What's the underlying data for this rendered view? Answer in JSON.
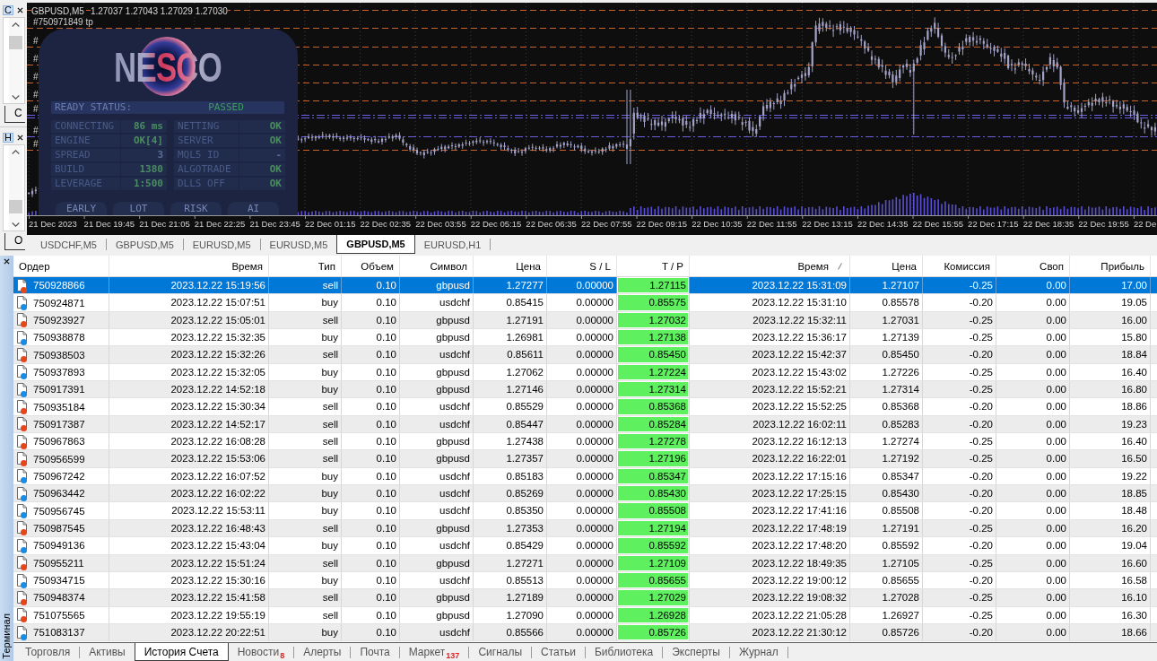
{
  "side_panels": [
    {
      "tab": "C",
      "label": "C"
    },
    {
      "tab": "H",
      "label": "O"
    }
  ],
  "chart": {
    "symbol": "GBPUSD,M5",
    "prices": "1.27037 1.27043 1.27029 1.27030",
    "line_labels": [
      "#750971849 tp",
      "#",
      "#",
      "#",
      "#",
      "#",
      "#",
      "#"
    ],
    "time_axis": [
      "21 Dec 2023",
      "21 Dec 19:45",
      "21 Dec 21:05",
      "21 Dec 22:25",
      "21 Dec 23:45",
      "22 Dec 01:15",
      "22 Dec 02:35",
      "22 Dec 03:55",
      "22 Dec 05:15",
      "22 Dec 06:35",
      "22 Dec 07:55",
      "22 Dec 09:15",
      "22 Dec 10:35",
      "22 Dec 11:55",
      "22 Dec 13:15",
      "22 Dec 14:35",
      "22 Dec 15:55",
      "22 Dec 17:15",
      "22 Dec 18:35",
      "22 Dec 19:55",
      "22 De"
    ],
    "status_panel": {
      "logo": "NESCO",
      "status": {
        "label": "READY STATUS:",
        "value": "PASSED"
      },
      "stats": [
        {
          "label": "CONNECTING",
          "value": "86 ms",
          "color": "#4b8c63"
        },
        {
          "label": "NETTING",
          "value": "OK",
          "color": "#4b8c63"
        },
        {
          "label": "ENGINE",
          "value": "OK[4]",
          "color": "#4b8c63"
        },
        {
          "label": "SERVER",
          "value": "OK",
          "color": "#4b8c63"
        },
        {
          "label": "SPREAD",
          "value": "3",
          "color": "#5d6d99"
        },
        {
          "label": "MQL5 ID",
          "value": "-",
          "color": "#5d6d99"
        },
        {
          "label": "BUILD",
          "value": "1380",
          "color": "#4b8c63"
        },
        {
          "label": "ALGOTRADE",
          "value": "OK",
          "color": "#4b8c63"
        },
        {
          "label": "LEVERAGE",
          "value": "1:500",
          "color": "#4b8c63"
        },
        {
          "label": "DLLS OFF",
          "value": "OK",
          "color": "#4b8c63"
        }
      ],
      "buttons": [
        "EARLY",
        "LOT",
        "RISK",
        "AI"
      ]
    }
  },
  "chart_tabs": [
    {
      "label": "USDCHF,M5",
      "selected": false
    },
    {
      "label": "GBPUSD,M5",
      "selected": false
    },
    {
      "label": "EURUSD,M5",
      "selected": false
    },
    {
      "label": "EURUSD,M5",
      "selected": false
    },
    {
      "label": "GBPUSD,M5",
      "selected": true
    },
    {
      "label": "EURUSD,H1",
      "selected": false
    }
  ],
  "terminal": {
    "title": "Терминал",
    "columns": [
      {
        "label": "Ордер",
        "sorted": false,
        "highlighted": false
      },
      {
        "label": "Время",
        "sorted": false,
        "highlighted": false
      },
      {
        "label": "Тип",
        "sorted": false,
        "highlighted": false
      },
      {
        "label": "Объем",
        "sorted": false,
        "highlighted": false
      },
      {
        "label": "Символ",
        "sorted": false,
        "highlighted": false
      },
      {
        "label": "Цена",
        "sorted": false,
        "highlighted": false
      },
      {
        "label": "S / L",
        "sorted": false,
        "highlighted": false
      },
      {
        "label": "T / P",
        "sorted": false,
        "highlighted": true
      },
      {
        "label": "Время",
        "sorted": true,
        "highlighted": false
      },
      {
        "label": "Цена",
        "sorted": false,
        "highlighted": false
      },
      {
        "label": "Комиссия",
        "sorted": false,
        "highlighted": false
      },
      {
        "label": "Своп",
        "sorted": false,
        "highlighted": false
      },
      {
        "label": "Прибыль",
        "sorted": false,
        "highlighted": false
      }
    ],
    "rows": [
      {
        "selected": true,
        "color": "#e4471c",
        "cells": [
          "750928866",
          "2023.12.22 15:19:56",
          "sell",
          "0.10",
          "gbpusd",
          "1.27277",
          "0.00000",
          "1.27115",
          "2023.12.22 15:31:09",
          "1.27107",
          "-0.25",
          "0.00",
          "17.00"
        ]
      },
      {
        "selected": false,
        "color": "#1c8ce3",
        "cells": [
          "750924871",
          "2023.12.22 15:07:51",
          "buy",
          "0.10",
          "usdchf",
          "0.85415",
          "0.00000",
          "0.85575",
          "2023.12.22 15:31:10",
          "0.85578",
          "-0.20",
          "0.00",
          "19.05"
        ]
      },
      {
        "selected": false,
        "color": "#e4471c",
        "cells": [
          "750923927",
          "2023.12.22 15:05:01",
          "sell",
          "0.10",
          "gbpusd",
          "1.27191",
          "0.00000",
          "1.27032",
          "2023.12.22 15:32:11",
          "1.27031",
          "-0.25",
          "0.00",
          "16.00"
        ]
      },
      {
        "selected": false,
        "color": "#1c8ce3",
        "cells": [
          "750938878",
          "2023.12.22 15:32:35",
          "buy",
          "0.10",
          "gbpusd",
          "1.26981",
          "0.00000",
          "1.27138",
          "2023.12.22 15:36:17",
          "1.27139",
          "-0.25",
          "0.00",
          "15.80"
        ]
      },
      {
        "selected": false,
        "color": "#e4471c",
        "cells": [
          "750938503",
          "2023.12.22 15:32:26",
          "sell",
          "0.10",
          "usdchf",
          "0.85611",
          "0.00000",
          "0.85450",
          "2023.12.22 15:42:37",
          "0.85450",
          "-0.20",
          "0.00",
          "18.84"
        ]
      },
      {
        "selected": false,
        "color": "#1c8ce3",
        "cells": [
          "750937893",
          "2023.12.22 15:32:05",
          "buy",
          "0.10",
          "gbpusd",
          "1.27062",
          "0.00000",
          "1.27224",
          "2023.12.22 15:43:02",
          "1.27226",
          "-0.25",
          "0.00",
          "16.40"
        ]
      },
      {
        "selected": false,
        "color": "#1c8ce3",
        "cells": [
          "750917391",
          "2023.12.22 14:52:18",
          "buy",
          "0.10",
          "gbpusd",
          "1.27146",
          "0.00000",
          "1.27314",
          "2023.12.22 15:52:21",
          "1.27314",
          "-0.25",
          "0.00",
          "16.80"
        ]
      },
      {
        "selected": false,
        "color": "#e4471c",
        "cells": [
          "750935184",
          "2023.12.22 15:30:34",
          "sell",
          "0.10",
          "usdchf",
          "0.85529",
          "0.00000",
          "0.85368",
          "2023.12.22 15:52:25",
          "0.85368",
          "-0.20",
          "0.00",
          "18.86"
        ]
      },
      {
        "selected": false,
        "color": "#e4471c",
        "cells": [
          "750917387",
          "2023.12.22 14:52:17",
          "sell",
          "0.10",
          "usdchf",
          "0.85447",
          "0.00000",
          "0.85284",
          "2023.12.22 16:02:11",
          "0.85283",
          "-0.20",
          "0.00",
          "19.23"
        ]
      },
      {
        "selected": false,
        "color": "#e4471c",
        "cells": [
          "750967863",
          "2023.12.22 16:08:28",
          "sell",
          "0.10",
          "gbpusd",
          "1.27438",
          "0.00000",
          "1.27278",
          "2023.12.22 16:12:13",
          "1.27274",
          "-0.25",
          "0.00",
          "16.40"
        ]
      },
      {
        "selected": false,
        "color": "#e4471c",
        "cells": [
          "750956599",
          "2023.12.22 15:53:06",
          "sell",
          "0.10",
          "gbpusd",
          "1.27357",
          "0.00000",
          "1.27196",
          "2023.12.22 16:22:01",
          "1.27192",
          "-0.25",
          "0.00",
          "16.50"
        ]
      },
      {
        "selected": false,
        "color": "#1c8ce3",
        "cells": [
          "750967242",
          "2023.12.22 16:07:52",
          "buy",
          "0.10",
          "usdchf",
          "0.85183",
          "0.00000",
          "0.85347",
          "2023.12.22 17:15:16",
          "0.85347",
          "-0.20",
          "0.00",
          "19.22"
        ]
      },
      {
        "selected": false,
        "color": "#1c8ce3",
        "cells": [
          "750963442",
          "2023.12.22 16:02:22",
          "buy",
          "0.10",
          "usdchf",
          "0.85269",
          "0.00000",
          "0.85430",
          "2023.12.22 17:25:15",
          "0.85430",
          "-0.20",
          "0.00",
          "18.85"
        ]
      },
      {
        "selected": false,
        "color": "#1c8ce3",
        "cells": [
          "750956745",
          "2023.12.22 15:53:11",
          "buy",
          "0.10",
          "usdchf",
          "0.85350",
          "0.00000",
          "0.85508",
          "2023.12.22 17:41:16",
          "0.85508",
          "-0.20",
          "0.00",
          "18.48"
        ]
      },
      {
        "selected": false,
        "color": "#e4471c",
        "cells": [
          "750987545",
          "2023.12.22 16:48:43",
          "sell",
          "0.10",
          "gbpusd",
          "1.27353",
          "0.00000",
          "1.27194",
          "2023.12.22 17:48:19",
          "1.27191",
          "-0.25",
          "0.00",
          "16.20"
        ]
      },
      {
        "selected": false,
        "color": "#1c8ce3",
        "cells": [
          "750949136",
          "2023.12.22 15:43:04",
          "buy",
          "0.10",
          "usdchf",
          "0.85429",
          "0.00000",
          "0.85592",
          "2023.12.22 17:48:20",
          "0.85592",
          "-0.20",
          "0.00",
          "19.04"
        ]
      },
      {
        "selected": false,
        "color": "#e4471c",
        "cells": [
          "750955211",
          "2023.12.22 15:51:24",
          "sell",
          "0.10",
          "gbpusd",
          "1.27271",
          "0.00000",
          "1.27109",
          "2023.12.22 18:49:35",
          "1.27105",
          "-0.25",
          "0.00",
          "16.60"
        ]
      },
      {
        "selected": false,
        "color": "#1c8ce3",
        "cells": [
          "750934715",
          "2023.12.22 15:30:16",
          "buy",
          "0.10",
          "usdchf",
          "0.85513",
          "0.00000",
          "0.85655",
          "2023.12.22 19:00:12",
          "0.85655",
          "-0.20",
          "0.00",
          "16.58"
        ]
      },
      {
        "selected": false,
        "color": "#e4471c",
        "cells": [
          "750948374",
          "2023.12.22 15:41:58",
          "sell",
          "0.10",
          "gbpusd",
          "1.27189",
          "0.00000",
          "1.27029",
          "2023.12.22 19:08:32",
          "1.27028",
          "-0.25",
          "0.00",
          "16.10"
        ]
      },
      {
        "selected": false,
        "color": "#e4471c",
        "cells": [
          "751075565",
          "2023.12.22 19:55:19",
          "sell",
          "0.10",
          "gbpusd",
          "1.27090",
          "0.00000",
          "1.26928",
          "2023.12.22 21:05:28",
          "1.26927",
          "-0.25",
          "0.00",
          "16.30"
        ]
      },
      {
        "selected": false,
        "color": "#1c8ce3",
        "cells": [
          "751083137",
          "2023.12.22 20:22:51",
          "buy",
          "0.10",
          "usdchf",
          "0.85566",
          "0.00000",
          "0.85726",
          "2023.12.22 21:30:12",
          "0.85726",
          "-0.20",
          "0.00",
          "18.66"
        ]
      }
    ],
    "tabs": [
      {
        "label": "Торговля",
        "selected": false
      },
      {
        "label": "Активы",
        "selected": false
      },
      {
        "label": "История Счета",
        "selected": true
      },
      {
        "label": "Новости",
        "badge": "8",
        "selected": false
      },
      {
        "label": "Алерты",
        "selected": false
      },
      {
        "label": "Почта",
        "selected": false
      },
      {
        "label": "Маркет",
        "badge": "137",
        "selected": false
      },
      {
        "label": "Сигналы",
        "selected": false
      },
      {
        "label": "Статьи",
        "selected": false
      },
      {
        "label": "Библиотека",
        "selected": false
      },
      {
        "label": "Эксперты",
        "selected": false
      },
      {
        "label": "Журнал",
        "selected": false
      }
    ]
  }
}
